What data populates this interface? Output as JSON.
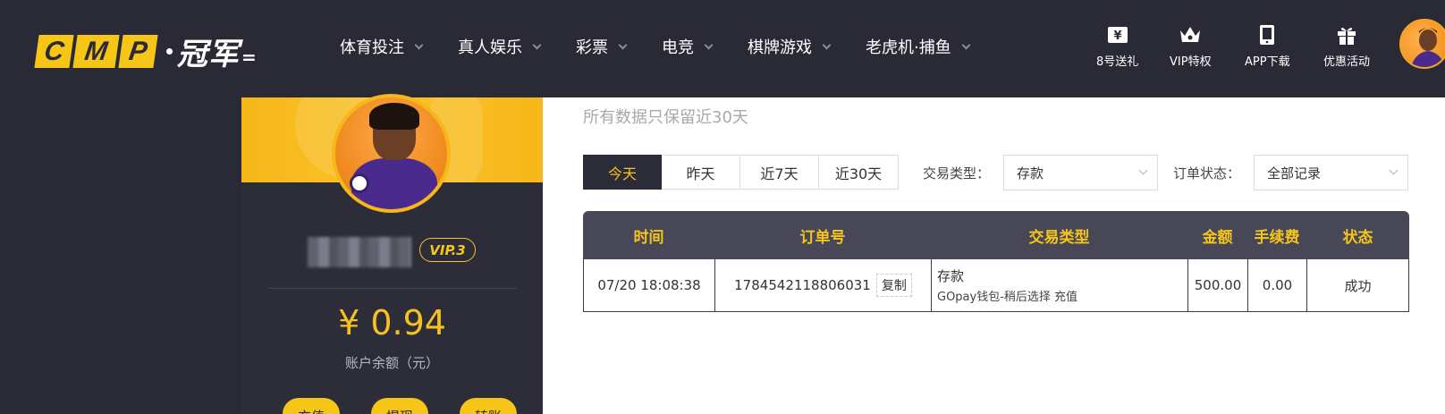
{
  "header": {
    "logo": {
      "tiles": [
        "C",
        "M",
        "P"
      ],
      "text": "冠军"
    },
    "nav": [
      {
        "label": "体育投注"
      },
      {
        "label": "真人娱乐"
      },
      {
        "label": "彩票"
      },
      {
        "label": "电竞"
      },
      {
        "label": "棋牌游戏"
      },
      {
        "label": "老虎机·捕鱼"
      }
    ],
    "quick_links": [
      {
        "label": "8号送礼",
        "icon": "ticket-icon"
      },
      {
        "label": "VIP特权",
        "icon": "crown-icon"
      },
      {
        "label": "APP下载",
        "icon": "phone-icon"
      },
      {
        "label": "优惠活动",
        "icon": "gift-icon"
      }
    ]
  },
  "profile": {
    "vip": "VIP.3",
    "balance": "¥ 0.94",
    "balance_label": "账户余额（元）",
    "actions": [
      "充值",
      "提现",
      "转账"
    ]
  },
  "main": {
    "notice": "所有数据只保留近30天",
    "date_tabs": [
      "今天",
      "昨天",
      "近7天",
      "近30天"
    ],
    "active_tab": "今天",
    "filters": {
      "type_label": "交易类型：",
      "type_value": "存款",
      "status_label": "订单状态：",
      "status_value": "全部记录"
    },
    "table": {
      "headers": [
        "时间",
        "订单号",
        "交易类型",
        "金额",
        "手续费",
        "状态"
      ],
      "rows": [
        {
          "time": "07/20 18:08:38",
          "order_no": "1784542118806031",
          "copy_label": "复制",
          "type_main": "存款",
          "type_sub": "GOpay钱包-稍后选择 充值",
          "amount": "500.00",
          "fee": "0.00",
          "status": "成功"
        }
      ]
    }
  },
  "colors": {
    "accent": "#f5c518",
    "dark_bg": "#2a2a37",
    "table_header_bg": "#474758",
    "success": "#2e9a2e"
  }
}
